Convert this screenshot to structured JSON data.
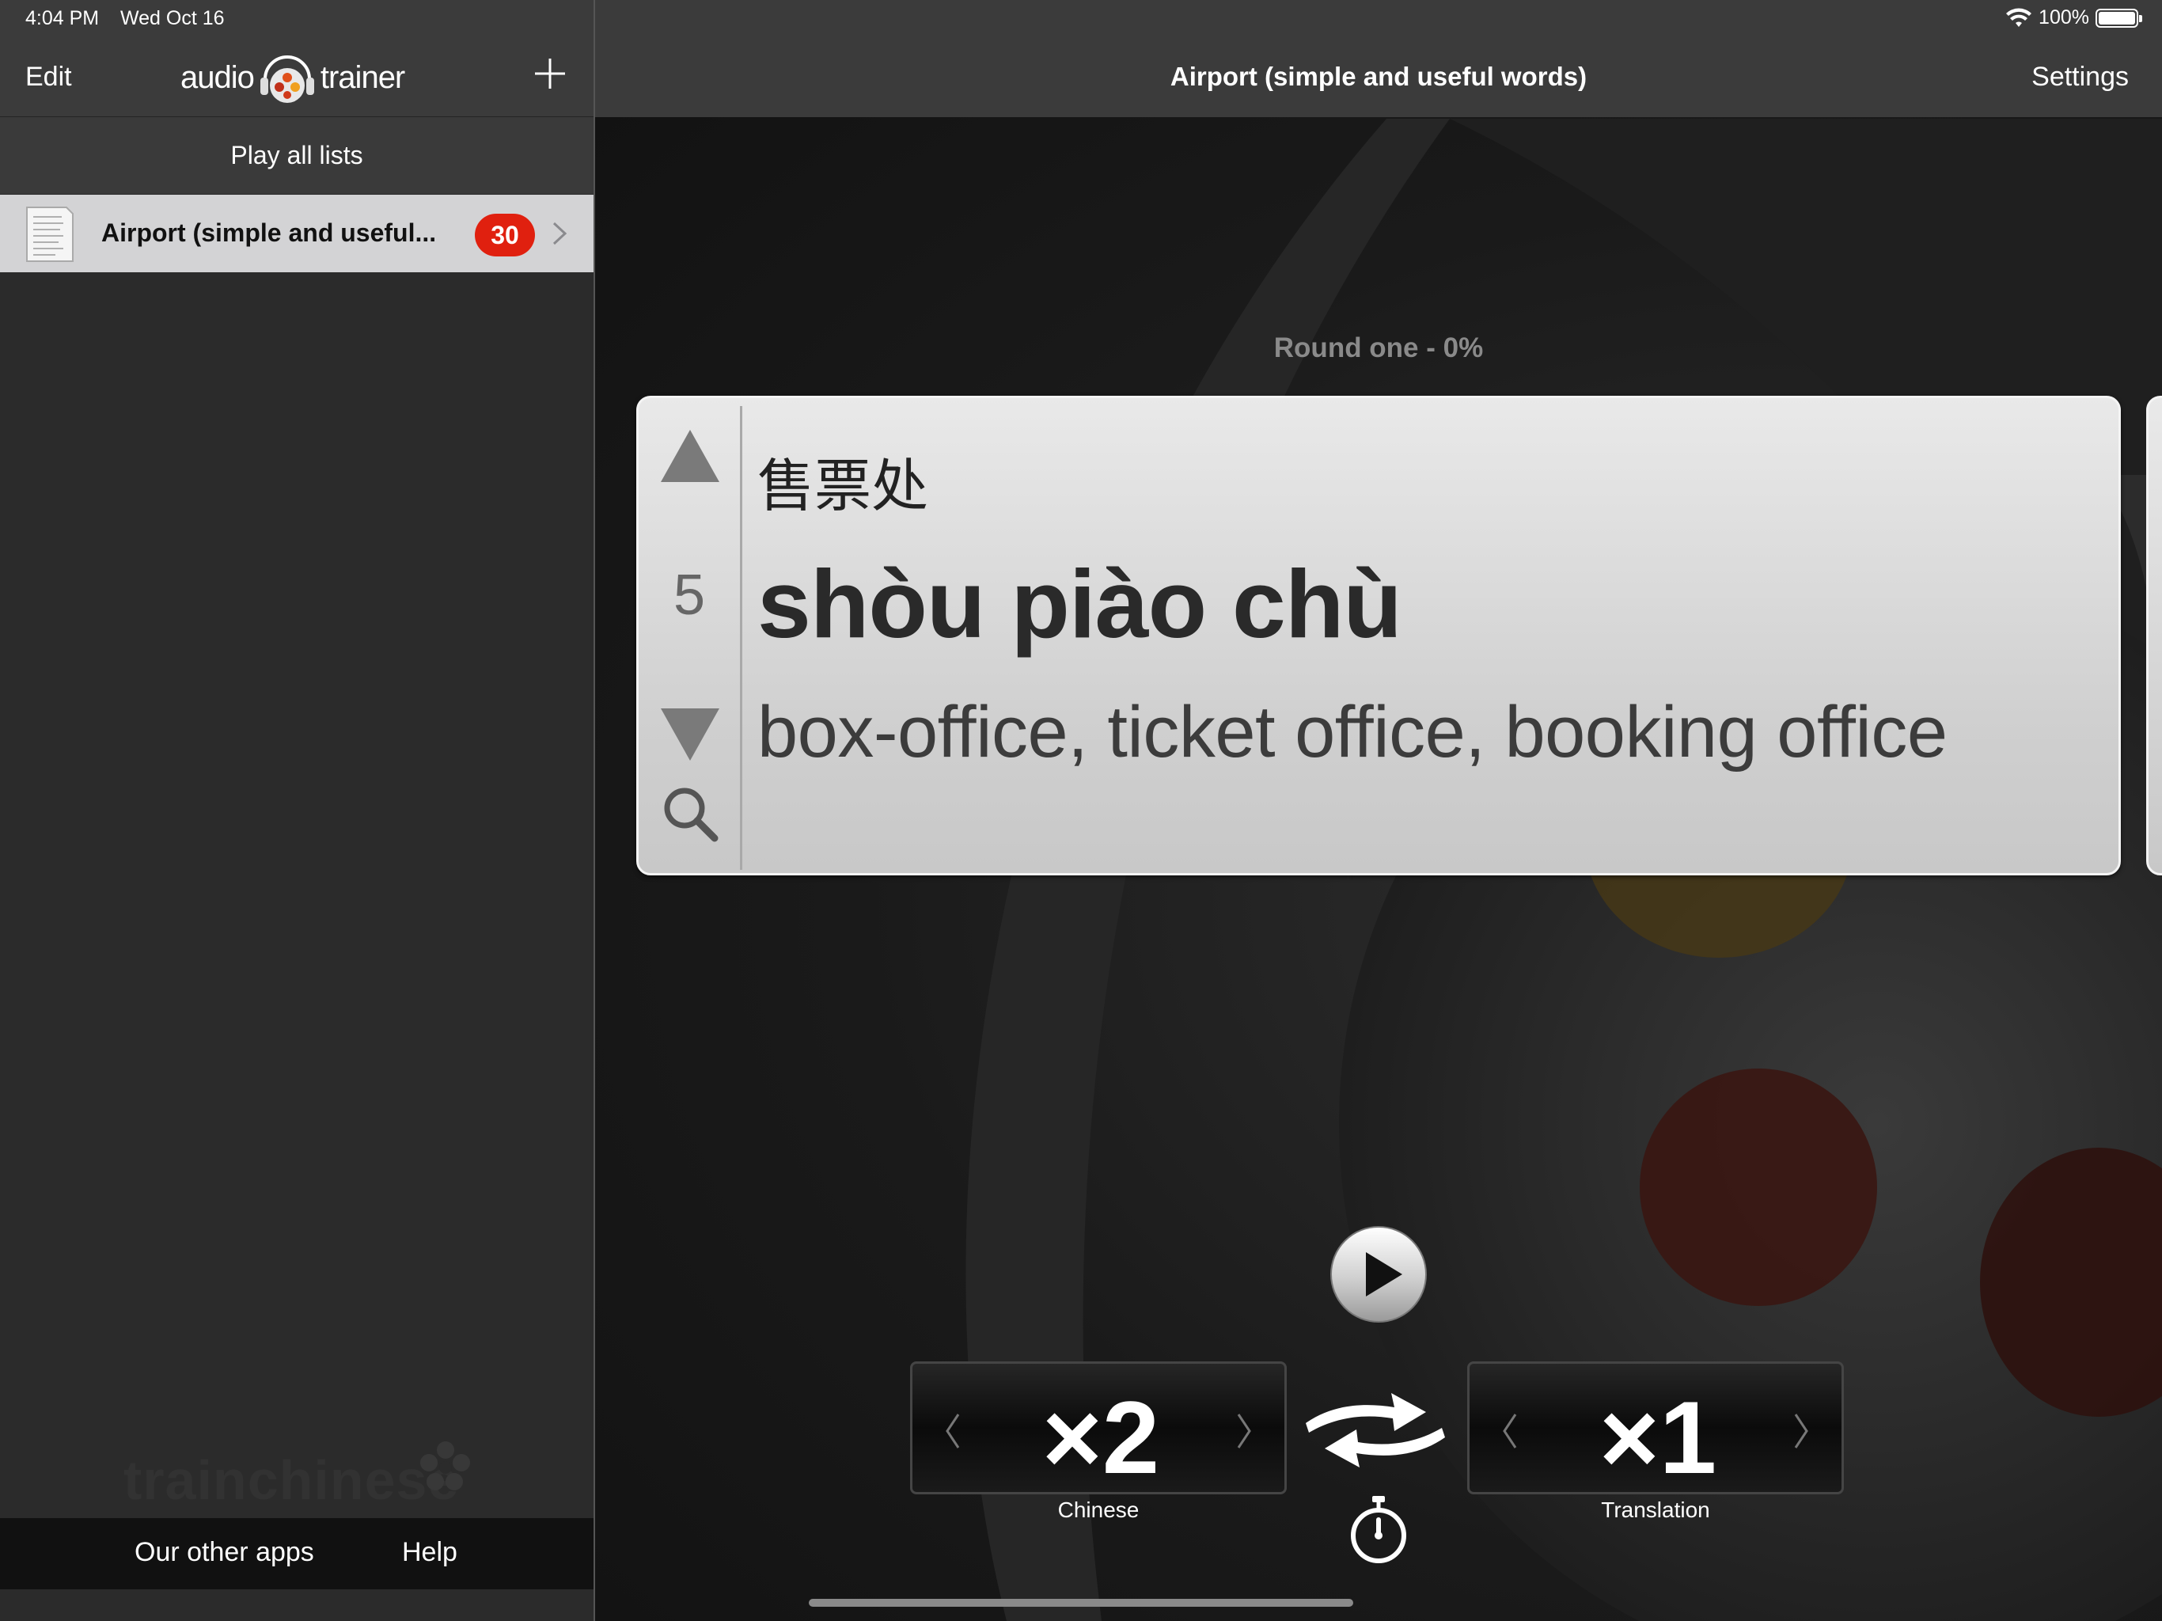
{
  "status": {
    "time": "4:04 PM",
    "date": "Wed Oct 16",
    "battery": "100%"
  },
  "sidebar": {
    "edit_label": "Edit",
    "logo_left": "audio",
    "logo_right": "trainer",
    "play_all_label": "Play all lists",
    "lists": [
      {
        "title": "Airport  (simple and useful...",
        "count": "30"
      }
    ],
    "watermark": "trainchinese",
    "footer": {
      "other_apps_label": "Our other apps",
      "help_label": "Help"
    }
  },
  "main": {
    "title": "Airport  (simple and useful words)",
    "settings_label": "Settings",
    "round_label": "Round one - 0%",
    "card": {
      "index": "5",
      "hanzi": "售票处",
      "pinyin": "shòu piào chù",
      "translation": "box-office, ticket office, booking office"
    },
    "chinese_counter": {
      "value": "×2",
      "label": "Chinese"
    },
    "translation_counter": {
      "value": "×1",
      "label": "Translation"
    }
  },
  "colors": {
    "badge": "#e0200f",
    "nav_bar": "#3b3b3b",
    "selected_row": "#d3d3d5"
  }
}
